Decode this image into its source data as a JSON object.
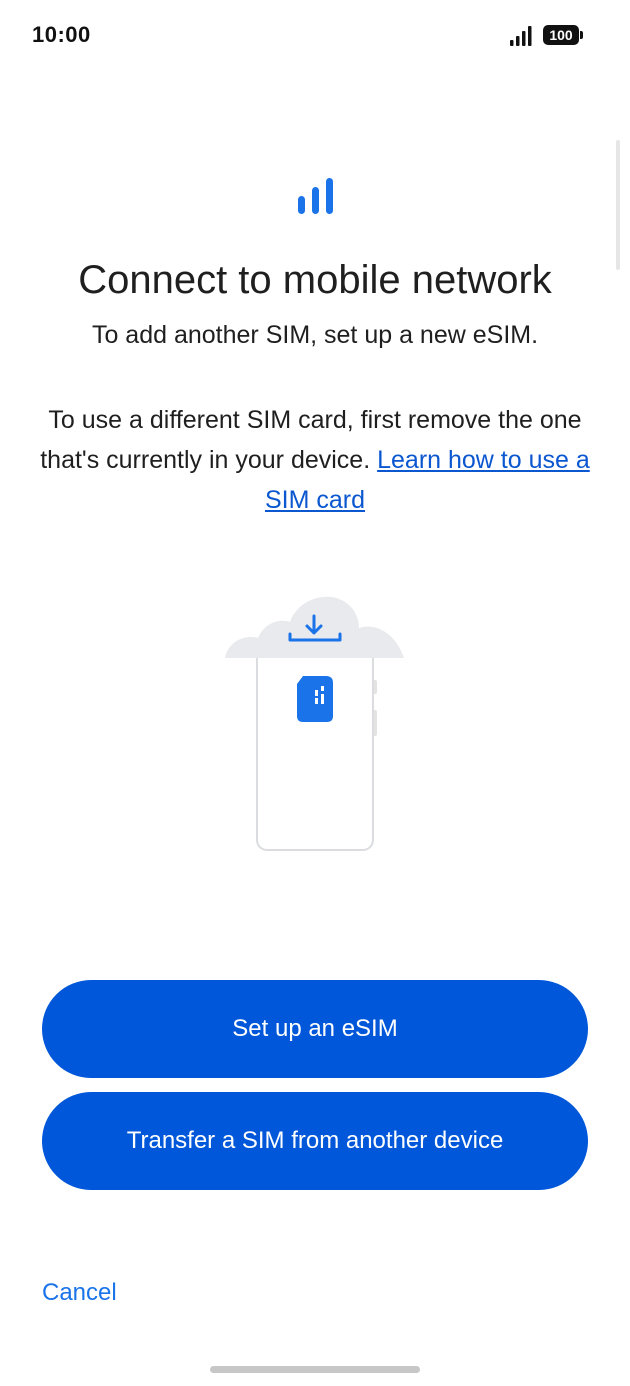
{
  "status_bar": {
    "time": "10:00",
    "battery": "100",
    "icons": [
      "signal-icon",
      "battery-icon"
    ]
  },
  "header": {
    "icon": "cellular-signal-icon",
    "title": "Connect to mobile network",
    "subtitle": "To add another SIM, set up a new eSIM."
  },
  "body": {
    "text": "To use a different SIM card, first remove the one that's currently in your device.",
    "link": "Learn how to use a SIM card"
  },
  "illustration": {
    "icons": [
      "cloud-icon",
      "download-icon",
      "phone-icon",
      "sim-card-icon"
    ]
  },
  "actions": {
    "setup_esim": "Set up an eSIM",
    "transfer_sim": "Transfer a SIM from another device",
    "cancel": "Cancel"
  },
  "colors": {
    "primary": "#0057d9",
    "link": "#0b57d0",
    "icon_blue": "#1a73e8",
    "text": "#1f1f1f"
  }
}
